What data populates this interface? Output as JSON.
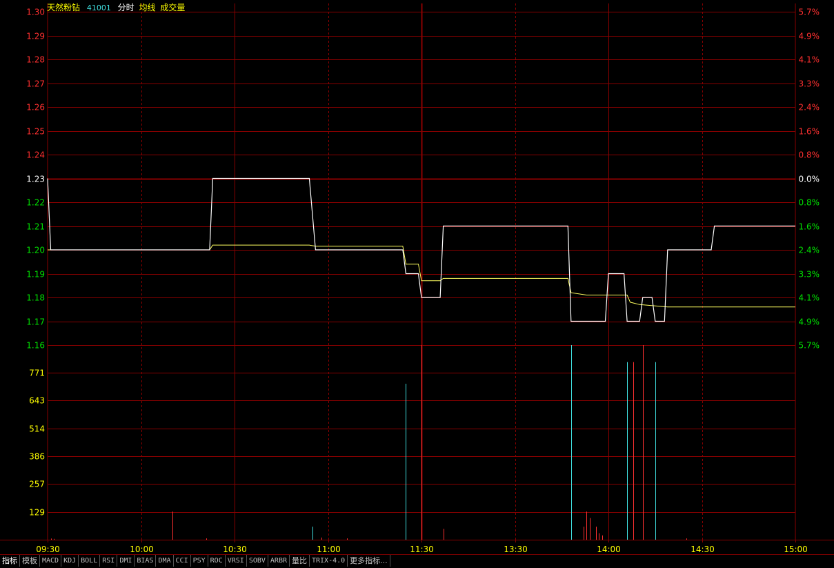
{
  "header": {
    "stock_name": "天然粉钻",
    "stock_code": "41001",
    "mode": "分时",
    "avg_label": "均线",
    "volume_label": "成交量"
  },
  "colors": {
    "grid": "#8a0000",
    "up": "#ff3030",
    "down": "#00e000",
    "flat": "#ffffff",
    "price_line": "#ffffff",
    "avg_line": "#ffff60",
    "volume_up": "#ff3030",
    "volume_down": "#40e0e0",
    "volume_axis": "#ffff00"
  },
  "price_axis": {
    "prev_close": 1.23,
    "left_labels": [
      "1.30",
      "1.29",
      "1.28",
      "1.27",
      "1.26",
      "1.25",
      "1.24",
      "1.23",
      "1.22",
      "1.21",
      "1.20",
      "1.19",
      "1.18",
      "1.17",
      "1.16"
    ],
    "right_labels": [
      "5.7%",
      "4.9%",
      "4.1%",
      "3.3%",
      "2.4%",
      "1.6%",
      "0.8%",
      "0.0%",
      "0.8%",
      "1.6%",
      "2.4%",
      "3.3%",
      "4.1%",
      "4.9%",
      "5.7%"
    ]
  },
  "volume_axis": {
    "labels": [
      "771",
      "643",
      "514",
      "386",
      "257",
      "129"
    ],
    "max": 771
  },
  "time_axis": {
    "labels": [
      "09:30",
      "10:00",
      "10:30",
      "11:00",
      "11:30",
      "13:30",
      "14:00",
      "14:30",
      "15:00"
    ],
    "total_minutes": 240
  },
  "chart_data": {
    "type": "line",
    "title": "",
    "x_unit": "trading minutes from 09:30",
    "series": [
      {
        "values": [
          [
            0,
            1.23
          ],
          [
            1,
            1.2
          ],
          [
            52,
            1.2
          ],
          [
            53,
            1.23
          ],
          [
            84,
            1.23
          ],
          [
            86,
            1.2
          ],
          [
            114,
            1.2
          ],
          [
            115,
            1.19
          ],
          [
            119,
            1.19
          ],
          [
            120,
            1.18
          ],
          [
            126,
            1.18
          ],
          [
            127,
            1.21
          ],
          [
            167,
            1.21
          ],
          [
            168,
            1.17
          ],
          [
            179,
            1.17
          ],
          [
            180,
            1.19
          ],
          [
            185,
            1.19
          ],
          [
            186,
            1.17
          ],
          [
            190,
            1.17
          ],
          [
            191,
            1.18
          ],
          [
            194,
            1.18
          ],
          [
            195,
            1.17
          ],
          [
            198,
            1.17
          ],
          [
            199,
            1.2
          ],
          [
            213,
            1.2
          ],
          [
            214,
            1.21
          ],
          [
            240,
            1.21
          ]
        ]
      },
      {
        "values": [
          [
            0,
            1.2
          ],
          [
            52,
            1.2
          ],
          [
            53,
            1.202
          ],
          [
            84,
            1.202
          ],
          [
            86,
            1.2015
          ],
          [
            114,
            1.2015
          ],
          [
            115,
            1.194
          ],
          [
            119,
            1.194
          ],
          [
            120,
            1.187
          ],
          [
            126,
            1.187
          ],
          [
            127,
            1.188
          ],
          [
            167,
            1.188
          ],
          [
            168,
            1.182
          ],
          [
            173,
            1.181
          ],
          [
            186,
            1.181
          ],
          [
            187,
            1.178
          ],
          [
            190,
            1.177
          ],
          [
            199,
            1.176
          ],
          [
            205,
            1.176
          ],
          [
            240,
            1.176
          ]
        ]
      }
    ],
    "volume": [
      {
        "t": 1,
        "v": 5,
        "dir": "up"
      },
      {
        "t": 2,
        "v": 4,
        "dir": "up"
      },
      {
        "t": 40,
        "v": 130,
        "dir": "up"
      },
      {
        "t": 51,
        "v": 6,
        "dir": "up"
      },
      {
        "t": 85,
        "v": 60,
        "dir": "down"
      },
      {
        "t": 88,
        "v": 10,
        "dir": "up"
      },
      {
        "t": 96,
        "v": 6,
        "dir": "up"
      },
      {
        "t": 115,
        "v": 720,
        "dir": "down"
      },
      {
        "t": 120,
        "v": 960,
        "dir": "up"
      },
      {
        "t": 127,
        "v": 50,
        "dir": "up"
      },
      {
        "t": 168,
        "v": 990,
        "dir": "down"
      },
      {
        "t": 172,
        "v": 60,
        "dir": "up"
      },
      {
        "t": 173,
        "v": 130,
        "dir": "up"
      },
      {
        "t": 174,
        "v": 100,
        "dir": "up"
      },
      {
        "t": 176,
        "v": 60,
        "dir": "up"
      },
      {
        "t": 177,
        "v": 30,
        "dir": "up"
      },
      {
        "t": 178,
        "v": 20,
        "dir": "up"
      },
      {
        "t": 186,
        "v": 820,
        "dir": "down"
      },
      {
        "t": 188,
        "v": 820,
        "dir": "up"
      },
      {
        "t": 191,
        "v": 1080,
        "dir": "up"
      },
      {
        "t": 195,
        "v": 820,
        "dir": "down"
      },
      {
        "t": 205,
        "v": 6,
        "dir": "up"
      }
    ]
  },
  "tabs": [
    {
      "label": "指标",
      "mono": false
    },
    {
      "label": "模板",
      "mono": false
    },
    {
      "label": "MACD",
      "mono": true
    },
    {
      "label": "KDJ",
      "mono": true
    },
    {
      "label": "BOLL",
      "mono": true
    },
    {
      "label": "RSI",
      "mono": true
    },
    {
      "label": "DMI",
      "mono": true
    },
    {
      "label": "BIAS",
      "mono": true
    },
    {
      "label": "DMA",
      "mono": true
    },
    {
      "label": "CCI",
      "mono": true
    },
    {
      "label": "PSY",
      "mono": true
    },
    {
      "label": "ROC",
      "mono": true
    },
    {
      "label": "VRSI",
      "mono": true
    },
    {
      "label": "SOBV",
      "mono": true
    },
    {
      "label": "ARBR",
      "mono": true
    },
    {
      "label": "量比",
      "mono": false
    },
    {
      "label": "TRIX-4.0",
      "mono": true
    },
    {
      "label": "更多指标...",
      "mono": false
    }
  ]
}
